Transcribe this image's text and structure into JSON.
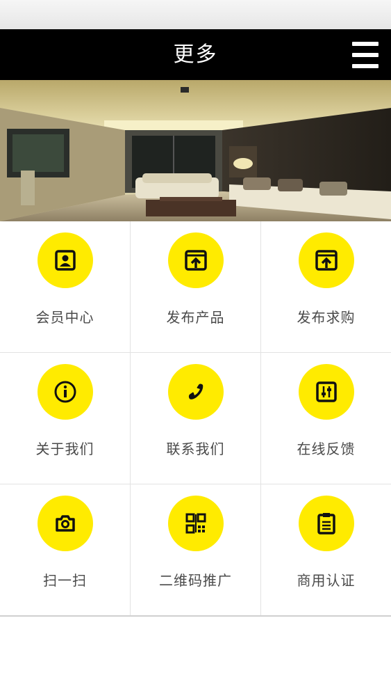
{
  "header": {
    "title": "更多",
    "menu_icon": "menu-icon"
  },
  "banner": {
    "image": "living-room-photo"
  },
  "colors": {
    "header_bg": "#000000",
    "accent": "#ffeb00",
    "label": "#4a4a4a"
  },
  "grid": {
    "items": [
      {
        "label": "会员中心",
        "icon": "member-card-icon"
      },
      {
        "label": "发布产品",
        "icon": "publish-product-icon"
      },
      {
        "label": "发布求购",
        "icon": "publish-request-icon"
      },
      {
        "label": "关于我们",
        "icon": "info-icon"
      },
      {
        "label": "联系我们",
        "icon": "phone-icon"
      },
      {
        "label": "在线反馈",
        "icon": "feedback-sliders-icon"
      },
      {
        "label": "扫一扫",
        "icon": "camera-icon"
      },
      {
        "label": "二维码推广",
        "icon": "qr-code-icon"
      },
      {
        "label": "商用认证",
        "icon": "clipboard-icon"
      }
    ]
  }
}
